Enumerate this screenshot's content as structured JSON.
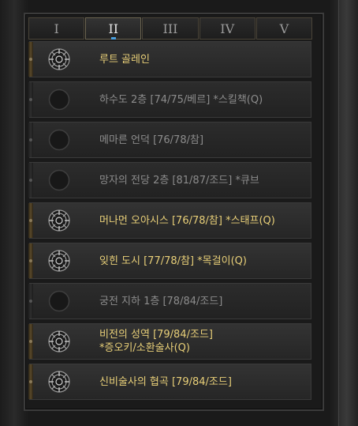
{
  "tabs": [
    {
      "label": "I",
      "active": false
    },
    {
      "label": "II",
      "active": true
    },
    {
      "label": "III",
      "active": false
    },
    {
      "label": "IV",
      "active": false
    },
    {
      "label": "V",
      "active": false
    }
  ],
  "waypoints": [
    {
      "label": "루트 골레인",
      "active": true,
      "icon": "waypoint-rune-icon"
    },
    {
      "label": "하수도 2층 [74/75/베르] *스킬책(Q)",
      "active": false,
      "icon": "empty-slot-icon"
    },
    {
      "label": "메마른 언덕 [76/78/참]",
      "active": false,
      "icon": "empty-slot-icon"
    },
    {
      "label": "망자의 전당 2층 [81/87/조드] *큐브",
      "active": false,
      "icon": "empty-slot-icon"
    },
    {
      "label": "머나먼 오아시스 [76/78/참] *스태프(Q)",
      "active": true,
      "icon": "waypoint-rune-icon"
    },
    {
      "label": "잊힌 도시 [77/78/참] *목걸이(Q)",
      "active": true,
      "icon": "waypoint-rune-icon"
    },
    {
      "label": "궁전 지하 1층 [78/84/조드]",
      "active": false,
      "icon": "empty-slot-icon"
    },
    {
      "label": "비전의 성역 [79/84/조드]\n*증오키/소환술사(Q)",
      "active": true,
      "icon": "waypoint-rune-icon"
    },
    {
      "label": "신비술사의 협곡 [79/84/조드]",
      "active": true,
      "icon": "waypoint-rune-icon"
    }
  ],
  "colors": {
    "active_text": "#e8cf78",
    "inactive_text": "#8c8c8c",
    "tab_indicator": "#4aa0e0"
  }
}
